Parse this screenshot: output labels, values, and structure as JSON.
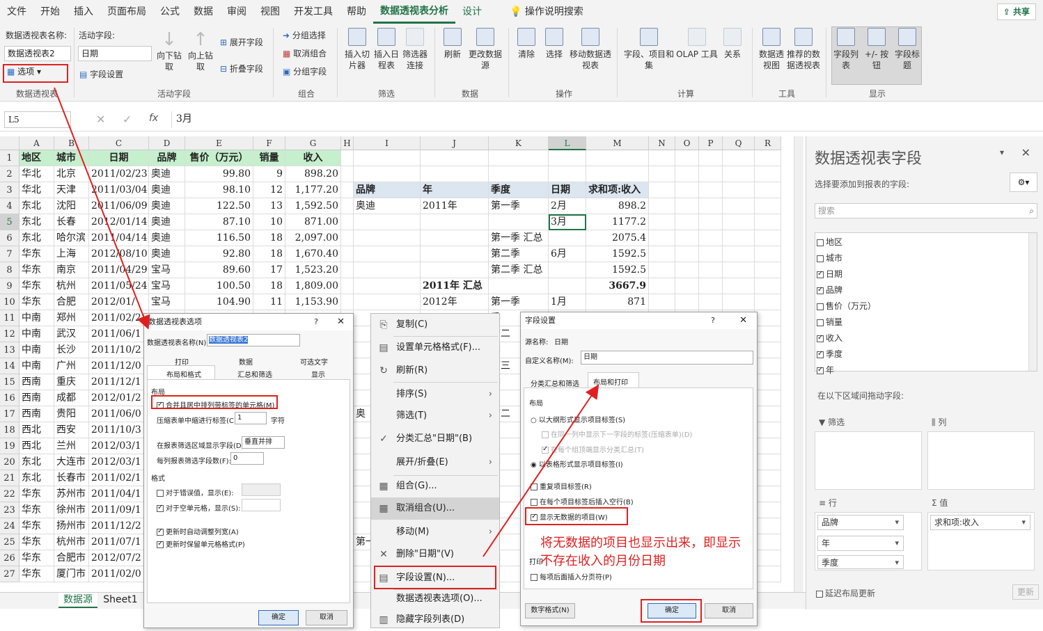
{
  "menu": [
    "文件",
    "开始",
    "插入",
    "页面布局",
    "公式",
    "数据",
    "审阅",
    "视图",
    "开发工具",
    "帮助",
    "数据透视表分析",
    "设计"
  ],
  "tell_me": "操作说明搜索",
  "share": "共享",
  "ribbon": {
    "pt_name_label": "数据透视表名称:",
    "pt_name_value": "数据透视表2",
    "options_btn": "选项",
    "group_pt": "数据透视表",
    "active_field_label": "活动字段:",
    "active_field_value": "日期",
    "field_settings": "字段设置",
    "drill_down": "向下钻取",
    "drill_up": "向上钻取",
    "expand": "展开字段",
    "collapse": "折叠字段",
    "group_active": "活动字段",
    "group_sel": "分组选择",
    "ungroup": "取消组合",
    "group_field": "分组字段",
    "group_group": "组合",
    "insert_slicer": "插入切片器",
    "insert_timeline": "插入日程表",
    "filter_conn": "筛选器连接",
    "group_filter": "筛选",
    "refresh": "刷新",
    "change_source": "更改数据源",
    "group_data": "数据",
    "clear": "清除",
    "select": "选择",
    "move_pt": "移动数据透视表",
    "group_ops": "操作",
    "fields_items": "字段、项目和集",
    "olap": "OLAP 工具",
    "relations": "关系",
    "group_calc": "计算",
    "pivot_chart": "数据透视图",
    "recommended": "推荐的数据透视表",
    "group_tools": "工具",
    "field_list": "字段列表",
    "pm_buttons": "+/- 按钮",
    "field_headers": "字段标题",
    "group_show": "显示"
  },
  "formula": {
    "cell_ref": "L5",
    "fx": "fx",
    "value": "3月"
  },
  "columns": [
    "A",
    "B",
    "C",
    "D",
    "E",
    "F",
    "G",
    "H",
    "I",
    "J",
    "K",
    "L",
    "M",
    "N",
    "O",
    "P",
    "Q",
    "R"
  ],
  "table_headers": [
    "地区",
    "城市",
    "日期",
    "品牌",
    "售价（万元）",
    "销量",
    "收入"
  ],
  "rows": [
    [
      "华北",
      "北京",
      "2011/02/23",
      "奥迪",
      "99.80",
      "9",
      "898.20"
    ],
    [
      "华北",
      "天津",
      "2011/03/04",
      "奥迪",
      "98.10",
      "12",
      "1,177.20"
    ],
    [
      "东北",
      "沈阳",
      "2011/06/09",
      "奥迪",
      "122.50",
      "13",
      "1,592.50"
    ],
    [
      "东北",
      "长春",
      "2012/01/14",
      "奥迪",
      "87.10",
      "10",
      "871.00"
    ],
    [
      "东北",
      "哈尔滨",
      "2011/04/14",
      "奥迪",
      "116.50",
      "18",
      "2,097.00"
    ],
    [
      "华东",
      "上海",
      "2012/08/10",
      "奥迪",
      "92.80",
      "18",
      "1,670.40"
    ],
    [
      "华东",
      "南京",
      "2011/04/29",
      "宝马",
      "89.60",
      "17",
      "1,523.20"
    ],
    [
      "华东",
      "杭州",
      "2011/05/24",
      "宝马",
      "100.50",
      "18",
      "1,809.00"
    ],
    [
      "华东",
      "合肥",
      "2012/01/",
      "宝马",
      "104.90",
      "11",
      "1,153.90"
    ],
    [
      "中南",
      "郑州",
      "2011/02/2",
      "",
      "",
      "",
      ""
    ],
    [
      "中南",
      "武汉",
      "2011/06/1",
      "",
      "",
      "",
      ""
    ],
    [
      "中南",
      "长沙",
      "2011/10/2",
      "",
      "",
      "",
      ""
    ],
    [
      "中南",
      "广州",
      "2011/12/0",
      "",
      "",
      "",
      ""
    ],
    [
      "西南",
      "重庆",
      "2011/12/1",
      "",
      "",
      "",
      ""
    ],
    [
      "西南",
      "成都",
      "2012/01/2",
      "",
      "",
      "",
      ""
    ],
    [
      "西南",
      "贵阳",
      "2011/06/0",
      "",
      "",
      "",
      ""
    ],
    [
      "西北",
      "西安",
      "2011/10/3",
      "",
      "",
      "",
      ""
    ],
    [
      "西北",
      "兰州",
      "2012/03/1",
      "",
      "",
      "",
      ""
    ],
    [
      "东北",
      "大连市",
      "2012/03/1",
      "",
      "",
      "",
      ""
    ],
    [
      "东北",
      "长春市",
      "2011/02/1",
      "",
      "",
      "",
      ""
    ],
    [
      "华东",
      "苏州市",
      "2011/04/1",
      "",
      "",
      "",
      ""
    ],
    [
      "华东",
      "徐州市",
      "2011/09/1",
      "",
      "",
      "",
      ""
    ],
    [
      "华东",
      "扬州市",
      "2011/12/2",
      "",
      "",
      "",
      ""
    ],
    [
      "华东",
      "杭州市",
      "2011/07/1",
      "",
      "",
      "",
      ""
    ],
    [
      "华东",
      "合肥市",
      "2012/07/2",
      "",
      "",
      "",
      ""
    ],
    [
      "华东",
      "厦门市",
      "2011/02/0",
      "",
      "",
      "",
      ""
    ]
  ],
  "pivot": {
    "headers": [
      "品牌",
      "年",
      "季度",
      "日期",
      "求和项:收入"
    ],
    "r3": [
      "奥迪",
      "2011年",
      "第一季",
      "2月",
      "898.2"
    ],
    "r4": [
      "",
      "",
      "",
      "3月",
      "1177.2"
    ],
    "r5": [
      "",
      "",
      "第一季 汇总",
      "",
      "2075.4"
    ],
    "r6": [
      "",
      "",
      "第二季",
      "6月",
      "1592.5"
    ],
    "r7": [
      "",
      "",
      "第二季 汇总",
      "",
      "1592.5"
    ],
    "r8": [
      "",
      "2011年 汇总",
      "",
      "",
      "3667.9"
    ],
    "r9": [
      "",
      "2012年",
      "第一季",
      "1月",
      "871"
    ],
    "frag": [
      "季",
      "第二",
      "季",
      "第三",
      "季",
      "奥",
      "第二",
      "季",
      "宝",
      "第一",
      "季"
    ]
  },
  "sheets": [
    "数据源",
    "Sheet1"
  ],
  "dlg_options": {
    "title": "数据透视表选项",
    "name_label": "数据透视表名称(N):",
    "name_value": "数据透视表2",
    "tabs_top": [
      "打印",
      "数据",
      "可选文字"
    ],
    "tabs_bottom": [
      "布局和格式",
      "汇总和筛选",
      "显示"
    ],
    "layout": "布局",
    "merge": "合并且居中排列带标签的单元格(M)",
    "indent": "压缩表单中缩进行标签(C):",
    "indent_val": "1",
    "chars": "字符",
    "filter_area": "在报表筛选区域显示字段(D):",
    "filter_area_val": "垂直并排",
    "per_col": "每列报表筛选字段数(F):",
    "per_col_val": "0",
    "format": "格式",
    "err": "对于错误值，显示(E):",
    "empty": "对于空单元格，显示(S):",
    "autofit": "更新时自动调整列宽(A)",
    "keep": "更新时保留单元格格式(P)",
    "ok": "确定",
    "cancel": "取消"
  },
  "ctx": [
    "复制(C)",
    "设置单元格格式(F)...",
    "刷新(R)",
    "排序(S)",
    "筛选(T)",
    "分类汇总\"日期\"(B)",
    "展开/折叠(E)",
    "组合(G)...",
    "取消组合(U)...",
    "移动(M)",
    "删除\"日期\"(V)",
    "字段设置(N)...",
    "数据透视表选项(O)...",
    "隐藏字段列表(D)"
  ],
  "dlg_field": {
    "title": "字段设置",
    "src_label": "源名称:",
    "src_value": "日期",
    "custom_label": "自定义名称(M):",
    "custom_value": "日期",
    "tabs": [
      "分类汇总和筛选",
      "布局和打印"
    ],
    "layout": "布局",
    "outline": "以大纲形式显示项目标签(S)",
    "same_col": "在同一列中显示下一字段的标签(压缩表单)(D)",
    "sub_top": "在每个组顶端显示分类汇总(T)",
    "tabular": "以表格形式显示项目标签(I)",
    "repeat": "重复项目标签(R)",
    "blank": "在每个项目标签后插入空行(B)",
    "no_data": "显示无数据的项目(W)",
    "print": "打印",
    "page_break": "每项后面插入分页符(P)",
    "num_fmt": "数字格式(N)",
    "ok": "确定",
    "cancel": "取消"
  },
  "annotation": "将无数据的项目也显示出来，即显示\n不存在收入的月份日期",
  "pane": {
    "title": "数据透视表字段",
    "choose": "选择要添加到报表的字段:",
    "search": "搜索",
    "fields": [
      {
        "name": "地区",
        "on": false
      },
      {
        "name": "城市",
        "on": false
      },
      {
        "name": "日期",
        "on": true
      },
      {
        "name": "品牌",
        "on": true
      },
      {
        "name": "售价（万元）",
        "on": false
      },
      {
        "name": "销量",
        "on": false
      },
      {
        "name": "收入",
        "on": true
      },
      {
        "name": "季度",
        "on": true
      },
      {
        "name": "年",
        "on": true
      }
    ],
    "drag": "在以下区域间拖动字段:",
    "filter": "筛选",
    "columns": "列",
    "rows": "行",
    "values": "值",
    "row_items": [
      "品牌",
      "年",
      "季度"
    ],
    "value_items": [
      "求和项:收入"
    ],
    "defer": "延迟布局更新",
    "update": "更新"
  },
  "colors": {
    "accent": "#217346",
    "annotation": "#e02020"
  }
}
